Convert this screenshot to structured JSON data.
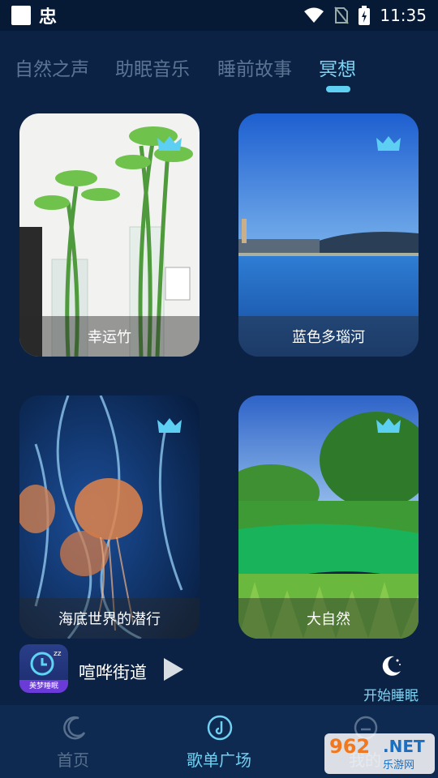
{
  "status_bar": {
    "time": "11:35",
    "app_glyph": "忠"
  },
  "tabs": [
    {
      "label": "自然之声"
    },
    {
      "label": "助眠音乐"
    },
    {
      "label": "睡前故事"
    },
    {
      "label": "冥想"
    }
  ],
  "cards": [
    {
      "title": "幸运竹",
      "icon": "crown-icon"
    },
    {
      "title": "蓝色多瑙河",
      "icon": "crown-icon"
    },
    {
      "title": "海底世界的潜行",
      "icon": "crown-icon"
    },
    {
      "title": "大自然",
      "icon": "crown-icon"
    }
  ],
  "player": {
    "song": "喧哗街道",
    "album_label": "美梦睡眠",
    "sleep_label": "开始睡眠"
  },
  "nav": [
    {
      "label": "首页"
    },
    {
      "label": "歌单广场"
    },
    {
      "label": "我的"
    }
  ],
  "watermark": {
    "num": "962",
    "net": ".NET",
    "sub": "乐游网"
  },
  "colors": {
    "accent": "#5fd0f2",
    "background": "#0b2244",
    "nav_bg": "#0f2a50"
  }
}
